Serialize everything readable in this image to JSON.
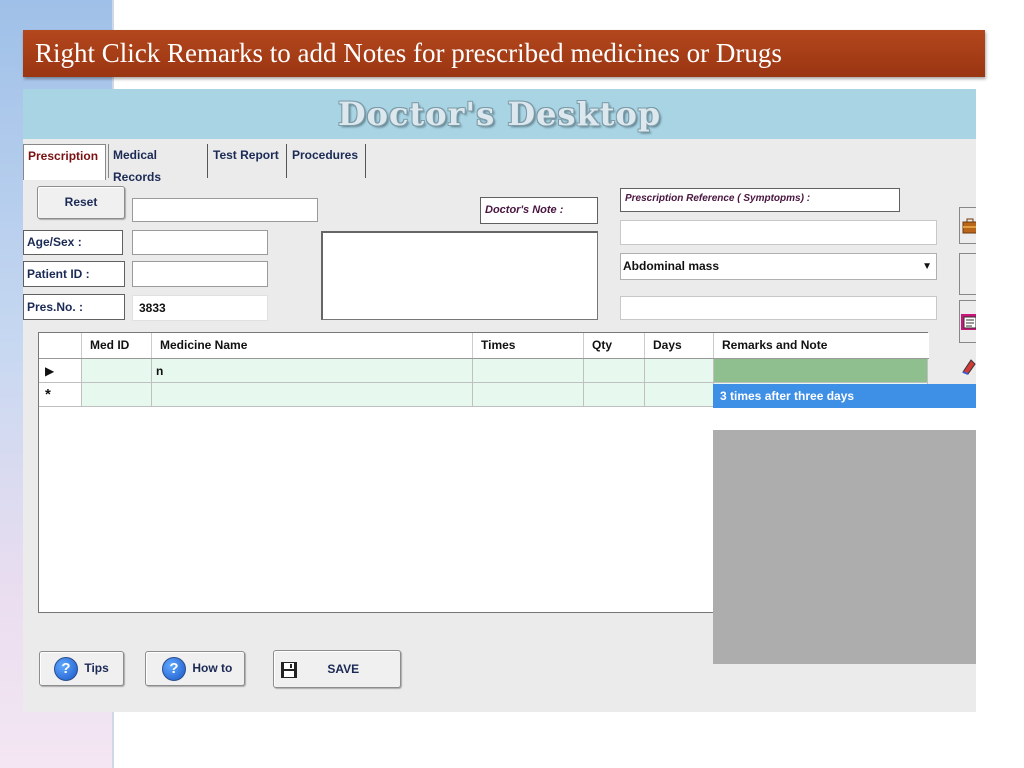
{
  "slide": {
    "title": "Right Click Remarks to add Notes for prescribed medicines or Drugs"
  },
  "app": {
    "title": "Doctor's Desktop",
    "tabs": [
      {
        "label": "Prescription",
        "active": true
      },
      {
        "label": "Medical Records",
        "active": false
      },
      {
        "label": "Test Report",
        "active": false
      },
      {
        "label": "Procedures",
        "active": false
      }
    ],
    "form": {
      "reset_label": "Reset",
      "name_value": "",
      "age_sex_label": "Age/Sex :",
      "age_sex_value": "",
      "patient_id_label": "Patient ID :",
      "patient_id_value": "",
      "pres_no_label": "Pres.No. :",
      "pres_no_value": "3833",
      "doctors_note_label": "Doctor's Note :",
      "doctors_note_value": "",
      "prescription_reference_label": "Prescription Reference ( Symptopms) :",
      "symptom_input_value": "",
      "symptom_dropdown_value": "Abdominal mass",
      "extra_input_value": ""
    },
    "grid": {
      "columns": [
        "",
        "Med ID",
        "Medicine Name",
        "Times",
        "Qty",
        "Days",
        "Remarks and Note"
      ],
      "rows": [
        {
          "marker": "▶",
          "med_id": "",
          "medicine_name": "n",
          "times": "",
          "qty": "",
          "days": "",
          "remarks": ""
        },
        {
          "marker": "*",
          "med_id": "",
          "medicine_name": "",
          "times": "",
          "qty": "",
          "days": "",
          "remarks": ""
        }
      ]
    },
    "remarks_suggestion": "3 times after three days",
    "buttons": {
      "tips_label": "Tips",
      "howto_label": "How to",
      "save_label": "SAVE"
    },
    "icons": {
      "help": "help-circle-icon",
      "save": "floppy-disk-icon",
      "briefcase": "briefcase-icon",
      "document": "document-icon",
      "eraser": "eraser-icon"
    },
    "colors": {
      "banner": "#a8401a",
      "header": "#a8d4e4",
      "selection": "#3e8fe6",
      "active_cell": "#8fbf8f",
      "grid_cell": "#e7f8ee"
    }
  }
}
